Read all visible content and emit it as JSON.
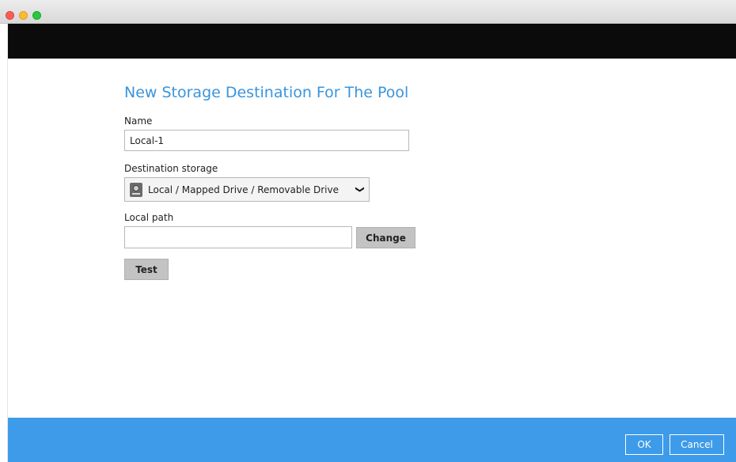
{
  "window": {
    "controls": [
      "close",
      "minimize",
      "maximize"
    ]
  },
  "dialog": {
    "title": "New Storage Destination For The Pool",
    "name_label": "Name",
    "name_value": "Local-1",
    "destination_label": "Destination storage",
    "destination_value": "Local / Mapped Drive / Removable Drive",
    "destination_icon": "hard-drive-icon",
    "local_path_label": "Local path",
    "local_path_value": "",
    "change_label": "Change",
    "test_label": "Test"
  },
  "footer": {
    "ok_label": "OK",
    "cancel_label": "Cancel"
  },
  "colors": {
    "accent_title": "#3a94dc",
    "footer_bg": "#3d9be9",
    "header_bg": "#0b0b0b",
    "button_gray": "#c3c3c3"
  }
}
